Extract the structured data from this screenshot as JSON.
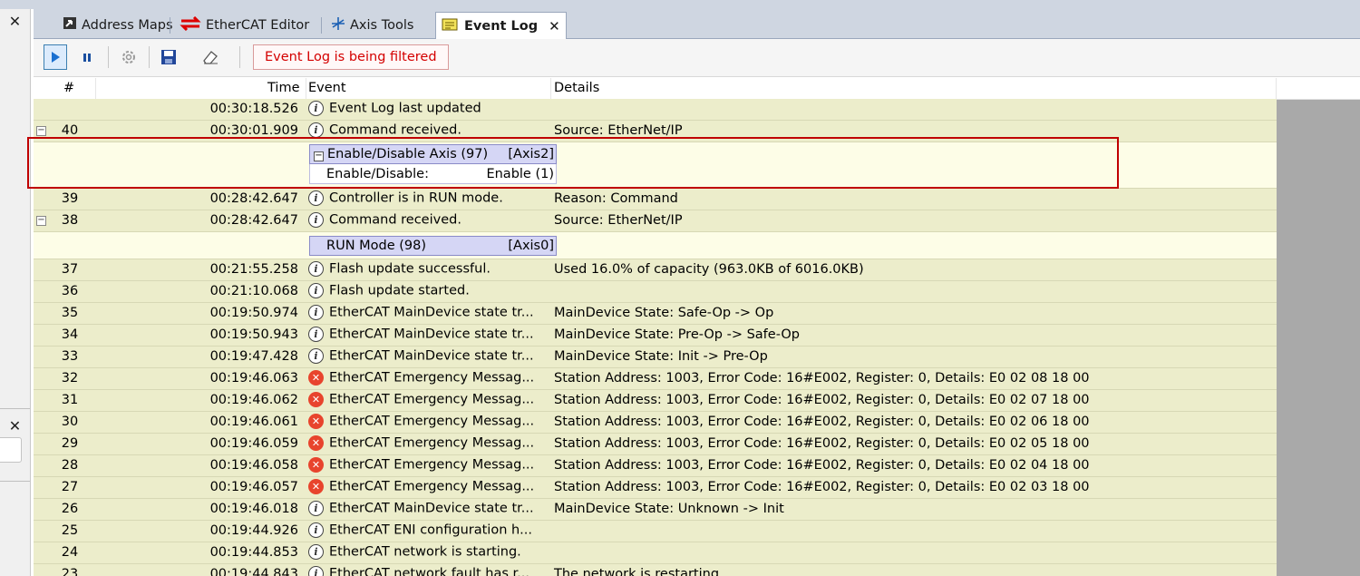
{
  "tabs": [
    {
      "label": "Address Maps",
      "icon": "address-map-icon"
    },
    {
      "label": "EtherCAT Editor",
      "icon": "ethercat-arrows-icon"
    },
    {
      "label": "Axis Tools",
      "icon": "axis-tools-icon"
    },
    {
      "label": "Event Log",
      "icon": "event-log-icon",
      "active": true,
      "close": "✕"
    }
  ],
  "left_panel": {
    "close1": "✕",
    "close2": "✕"
  },
  "toolbar": {
    "filter_notice": "Event Log is being filtered"
  },
  "columns": {
    "num": "#",
    "time": "Time",
    "event": "Event",
    "details": "Details"
  },
  "rows": [
    {
      "num": "",
      "time": "00:30:18.526",
      "icon": "info",
      "event": "Event Log last updated",
      "details": ""
    },
    {
      "num": "40",
      "time": "00:30:01.909",
      "icon": "info",
      "event": "Command received.",
      "details": "Source: EtherNet/IP",
      "expand": "−"
    },
    {
      "num": "39",
      "time": "00:28:42.647",
      "icon": "info",
      "event": "Controller is in RUN mode.",
      "details": "Reason: Command"
    },
    {
      "num": "38",
      "time": "00:28:42.647",
      "icon": "info",
      "event": "Command received.",
      "details": "Source: EtherNet/IP",
      "expand": "−"
    },
    {
      "num": "37",
      "time": "00:21:55.258",
      "icon": "info",
      "event": "Flash update successful.",
      "details": "Used 16.0% of capacity (963.0KB of 6016.0KB)"
    },
    {
      "num": "36",
      "time": "00:21:10.068",
      "icon": "info",
      "event": "Flash update started.",
      "details": ""
    },
    {
      "num": "35",
      "time": "00:19:50.974",
      "icon": "info",
      "event": "EtherCAT MainDevice state tr...",
      "details": "MainDevice State: Safe-Op -> Op"
    },
    {
      "num": "34",
      "time": "00:19:50.943",
      "icon": "info",
      "event": "EtherCAT MainDevice state tr...",
      "details": "MainDevice State: Pre-Op -> Safe-Op"
    },
    {
      "num": "33",
      "time": "00:19:47.428",
      "icon": "info",
      "event": "EtherCAT MainDevice state tr...",
      "details": "MainDevice State: Init -> Pre-Op"
    },
    {
      "num": "32",
      "time": "00:19:46.063",
      "icon": "error",
      "event": "EtherCAT Emergency Messag...",
      "details": "Station Address: 1003, Error Code: 16#E002, Register: 0, Details: E0 02 08 18 00"
    },
    {
      "num": "31",
      "time": "00:19:46.062",
      "icon": "error",
      "event": "EtherCAT Emergency Messag...",
      "details": "Station Address: 1003, Error Code: 16#E002, Register: 0, Details: E0 02 07 18 00"
    },
    {
      "num": "30",
      "time": "00:19:46.061",
      "icon": "error",
      "event": "EtherCAT Emergency Messag...",
      "details": "Station Address: 1003, Error Code: 16#E002, Register: 0, Details: E0 02 06 18 00"
    },
    {
      "num": "29",
      "time": "00:19:46.059",
      "icon": "error",
      "event": "EtherCAT Emergency Messag...",
      "details": "Station Address: 1003, Error Code: 16#E002, Register: 0, Details: E0 02 05 18 00"
    },
    {
      "num": "28",
      "time": "00:19:46.058",
      "icon": "error",
      "event": "EtherCAT Emergency Messag...",
      "details": "Station Address: 1003, Error Code: 16#E002, Register: 0, Details: E0 02 04 18 00"
    },
    {
      "num": "27",
      "time": "00:19:46.057",
      "icon": "error",
      "event": "EtherCAT Emergency Messag...",
      "details": "Station Address: 1003, Error Code: 16#E002, Register: 0, Details: E0 02 03 18 00"
    },
    {
      "num": "26",
      "time": "00:19:46.018",
      "icon": "info",
      "event": "EtherCAT MainDevice state tr...",
      "details": "MainDevice State: Unknown -> Init"
    },
    {
      "num": "25",
      "time": "00:19:44.926",
      "icon": "info",
      "event": "EtherCAT ENI configuration h...",
      "details": ""
    },
    {
      "num": "24",
      "time": "00:19:44.853",
      "icon": "info",
      "event": "EtherCAT network is starting.",
      "details": ""
    },
    {
      "num": "23",
      "time": "00:19:44.843",
      "icon": "info",
      "event": "EtherCAT network fault has r...",
      "details": "The network is restarting"
    }
  ],
  "sub40": {
    "expand": "−",
    "title": "Enable/Disable Axis (97)",
    "tag": "[Axis2]",
    "param_label": "Enable/Disable:",
    "param_value": "Enable (1)"
  },
  "sub38": {
    "title": "RUN Mode (98)",
    "tag": "[Axis0]"
  }
}
